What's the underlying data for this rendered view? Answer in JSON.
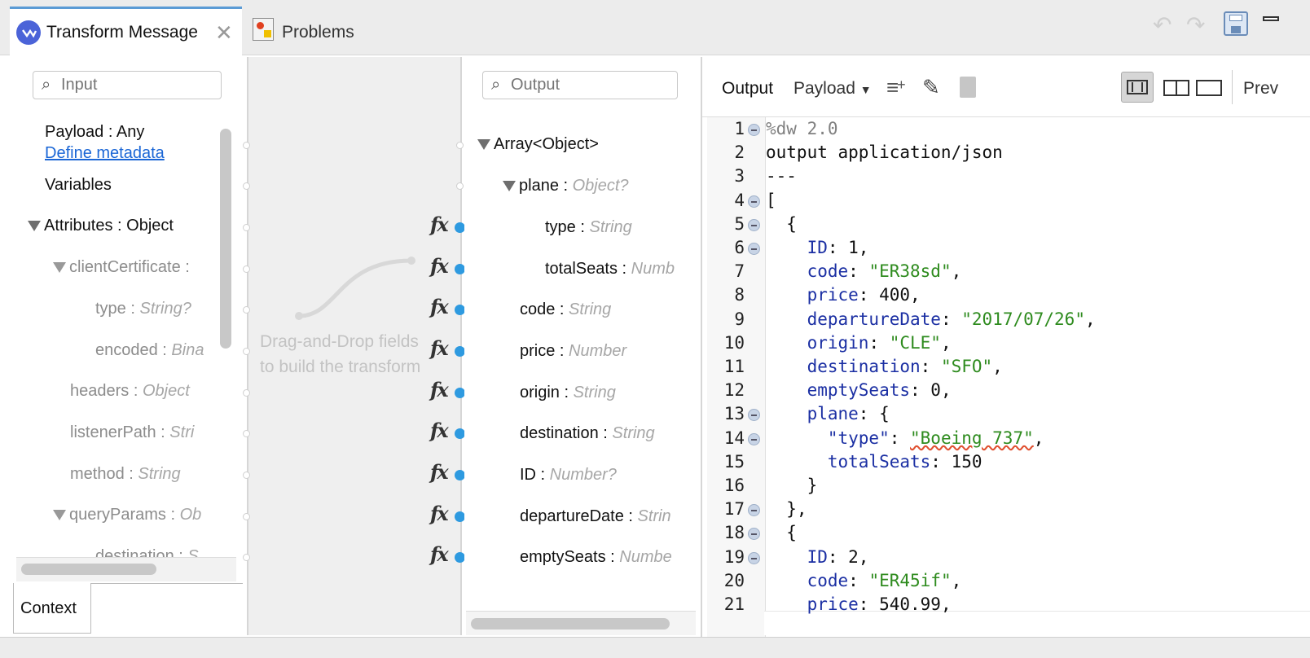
{
  "tabs": [
    {
      "label": "Transform Message",
      "active": true
    },
    {
      "label": "Problems",
      "active": false
    }
  ],
  "input": {
    "placeholder": "Input",
    "items": [
      {
        "name": "Payload",
        "sep": " : ",
        "type": "Any",
        "italic": false
      },
      {
        "link": "Define metadata"
      },
      {
        "name": "Variables"
      },
      {
        "name": "Attributes",
        "sep": " : ",
        "type": "Object"
      },
      {
        "name": "clientCertificate",
        "sep": " : ",
        "type": ""
      },
      {
        "name": "type",
        "sep": " : ",
        "type": "String?"
      },
      {
        "name": "encoded",
        "sep": " : ",
        "type": "Bina"
      },
      {
        "name": "headers",
        "sep": " : ",
        "type": "Object"
      },
      {
        "name": "listenerPath",
        "sep": " : ",
        "type": "Stri"
      },
      {
        "name": "method",
        "sep": " : ",
        "type": "String"
      },
      {
        "name": "queryParams",
        "sep": " : ",
        "type": "Ob"
      },
      {
        "name": "destination",
        "sep": " : ",
        "type": "S"
      }
    ],
    "context_tab": "Context"
  },
  "mapping": {
    "hint_line1": "Drag-and-Drop fields",
    "hint_line2": "to build the transform"
  },
  "output_tree": {
    "placeholder": "Output",
    "items": [
      {
        "name": "Array<Object>",
        "sep": "",
        "type": ""
      },
      {
        "name": "plane",
        "sep": " : ",
        "type": "Object?"
      },
      {
        "name": "type",
        "sep": " : ",
        "type": "String"
      },
      {
        "name": "totalSeats",
        "sep": " : ",
        "type": "Numb"
      },
      {
        "name": "code",
        "sep": " : ",
        "type": "String"
      },
      {
        "name": "price",
        "sep": " : ",
        "type": "Number"
      },
      {
        "name": "origin",
        "sep": " : ",
        "type": "String"
      },
      {
        "name": "destination",
        "sep": " : ",
        "type": "String"
      },
      {
        "name": "ID",
        "sep": " : ",
        "type": "Number?"
      },
      {
        "name": "departureDate",
        "sep": " : ",
        "type": "Strin"
      },
      {
        "name": "emptySeats",
        "sep": " : ",
        "type": "Numbe"
      }
    ],
    "fx": "fx"
  },
  "editor": {
    "output_label": "Output",
    "payload_label": "Payload",
    "preview_label": "Prev",
    "lines": [
      {
        "n": "1",
        "t": [
          [
            "%dw 2.0",
            "c"
          ]
        ]
      },
      {
        "n": "2",
        "t": [
          [
            "output application/json",
            "n"
          ]
        ]
      },
      {
        "n": "3",
        "t": [
          [
            "---",
            "n"
          ]
        ]
      },
      {
        "n": "4",
        "t": [
          [
            "[",
            "n"
          ]
        ]
      },
      {
        "n": "5",
        "t": [
          [
            "  {",
            "n"
          ]
        ]
      },
      {
        "n": "6",
        "t": [
          [
            "    ",
            "n"
          ],
          [
            "ID",
            "k"
          ],
          [
            ": 1,",
            "n"
          ]
        ]
      },
      {
        "n": "7",
        "t": [
          [
            "    ",
            "n"
          ],
          [
            "code",
            "k"
          ],
          [
            ": ",
            "n"
          ],
          [
            "\"ER38sd\"",
            "s"
          ],
          [
            ",",
            "n"
          ]
        ]
      },
      {
        "n": "8",
        "t": [
          [
            "    ",
            "n"
          ],
          [
            "price",
            "k"
          ],
          [
            ": 400,",
            "n"
          ]
        ]
      },
      {
        "n": "9",
        "t": [
          [
            "    ",
            "n"
          ],
          [
            "departureDate",
            "k"
          ],
          [
            ": ",
            "n"
          ],
          [
            "\"2017/07/26\"",
            "s"
          ],
          [
            ",",
            "n"
          ]
        ]
      },
      {
        "n": "10",
        "t": [
          [
            "    ",
            "n"
          ],
          [
            "origin",
            "k"
          ],
          [
            ": ",
            "n"
          ],
          [
            "\"CLE\"",
            "s"
          ],
          [
            ",",
            "n"
          ]
        ]
      },
      {
        "n": "11",
        "t": [
          [
            "    ",
            "n"
          ],
          [
            "destination",
            "k"
          ],
          [
            ": ",
            "n"
          ],
          [
            "\"SFO\"",
            "s"
          ],
          [
            ",",
            "n"
          ]
        ]
      },
      {
        "n": "12",
        "t": [
          [
            "    ",
            "n"
          ],
          [
            "emptySeats",
            "k"
          ],
          [
            ": 0,",
            "n"
          ]
        ]
      },
      {
        "n": "13",
        "t": [
          [
            "    ",
            "n"
          ],
          [
            "plane",
            "k"
          ],
          [
            ": {",
            "n"
          ]
        ]
      },
      {
        "n": "14",
        "t": [
          [
            "      ",
            "n"
          ],
          [
            "\"type\"",
            "k"
          ],
          [
            ": ",
            "n"
          ],
          [
            "\"Boeing 737\"",
            "s"
          ],
          [
            ",",
            "n"
          ]
        ]
      },
      {
        "n": "15",
        "t": [
          [
            "      ",
            "n"
          ],
          [
            "totalSeats",
            "k"
          ],
          [
            ": 150",
            "n"
          ]
        ]
      },
      {
        "n": "16",
        "t": [
          [
            "    }",
            "n"
          ]
        ]
      },
      {
        "n": "17",
        "t": [
          [
            "  },",
            "n"
          ]
        ]
      },
      {
        "n": "18",
        "t": [
          [
            "  {",
            "n"
          ]
        ]
      },
      {
        "n": "19",
        "t": [
          [
            "    ",
            "n"
          ],
          [
            "ID",
            "k"
          ],
          [
            ": 2,",
            "n"
          ]
        ]
      },
      {
        "n": "20",
        "t": [
          [
            "    ",
            "n"
          ],
          [
            "code",
            "k"
          ],
          [
            ": ",
            "n"
          ],
          [
            "\"ER45if\"",
            "s"
          ],
          [
            ",",
            "n"
          ]
        ]
      },
      {
        "n": "21",
        "t": [
          [
            "    ",
            "n"
          ],
          [
            "price",
            "k"
          ],
          [
            ": 540.99,",
            "n"
          ]
        ]
      }
    ]
  }
}
